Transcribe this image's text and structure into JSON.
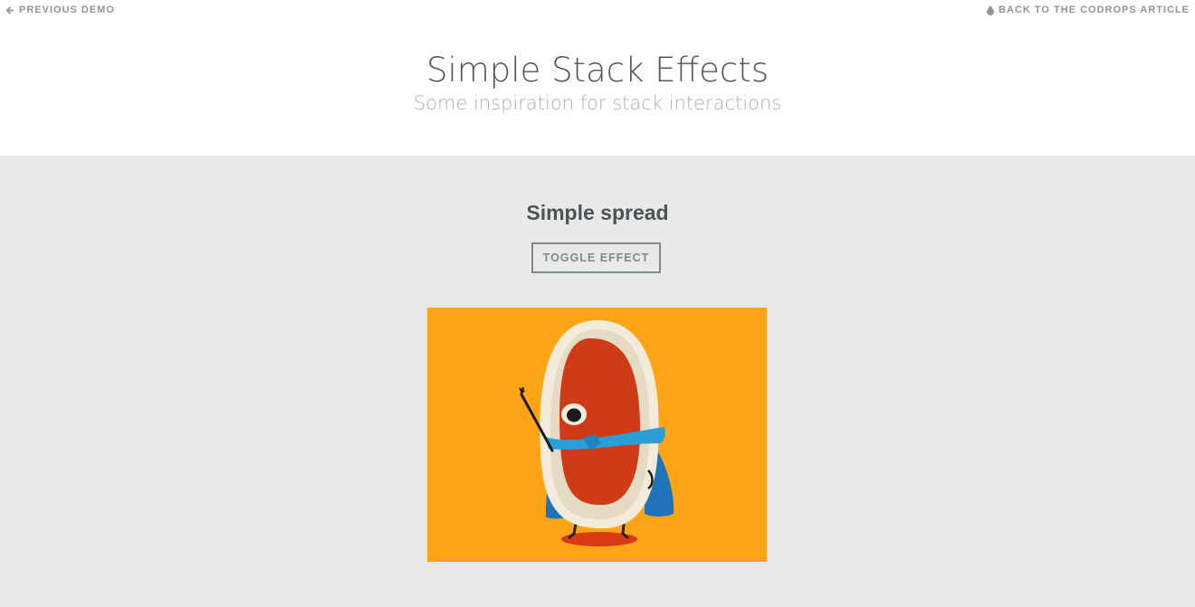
{
  "nav": {
    "previous_label": "PREVIOUS DEMO",
    "previous_icon": "arrow-left-icon",
    "back_label": "BACK TO THE CODROPS ARTICLE",
    "back_icon": "drop-icon"
  },
  "header": {
    "title": "Simple Stack Effects",
    "subtitle": "Some inspiration for stack interactions"
  },
  "section": {
    "title": "Simple spread",
    "toggle_label": "TOGGLE EFFECT"
  },
  "image": {
    "description_icon": "superhero-character-illustration",
    "background_color": "#fda517"
  },
  "colors": {
    "page_background": "#e9e9e9",
    "header_background": "#ffffff",
    "text_dark": "#4a5555",
    "text_muted": "#a8b0b0",
    "nav_link": "#8e9696"
  }
}
